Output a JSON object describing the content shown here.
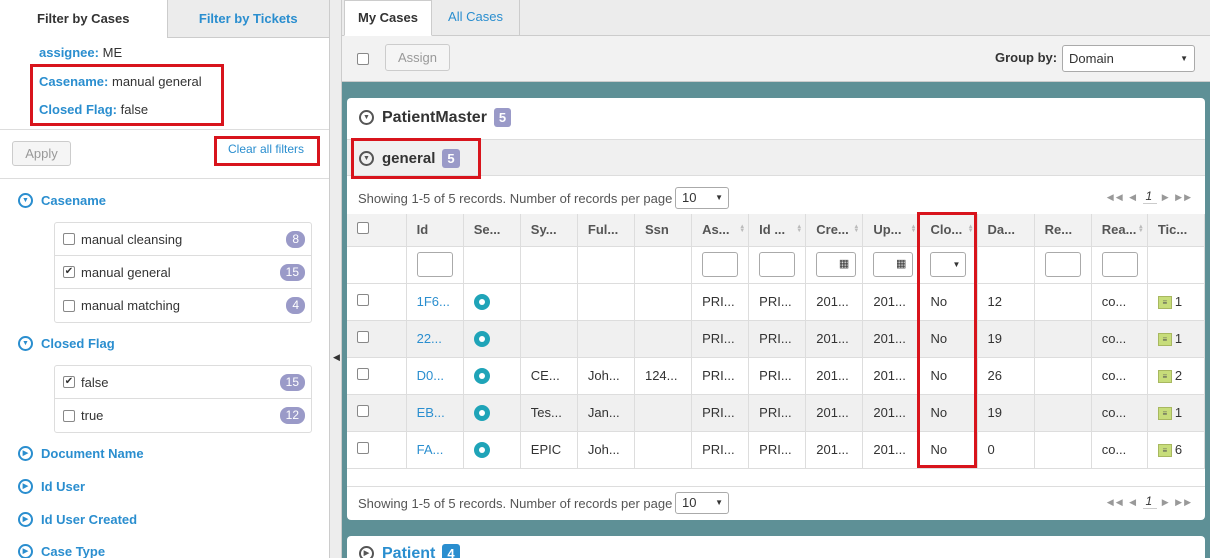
{
  "left_tabs": [
    "Filter by Cases",
    "Filter by Tickets"
  ],
  "active_filters": [
    {
      "key": "assignee:",
      "value": "ME"
    },
    {
      "key": "Casename:",
      "value": "manual general"
    },
    {
      "key": "Closed Flag:",
      "value": "false"
    }
  ],
  "apply_label": "Apply",
  "clear_label": "Clear all filters",
  "facets": {
    "casename": {
      "label": "Casename",
      "items": [
        {
          "label": "manual cleansing",
          "count": "8",
          "checked": false
        },
        {
          "label": "manual general",
          "count": "15",
          "checked": true
        },
        {
          "label": "manual matching",
          "count": "4",
          "checked": false
        }
      ]
    },
    "closed_flag": {
      "label": "Closed Flag",
      "items": [
        {
          "label": "false",
          "count": "15",
          "checked": true
        },
        {
          "label": "true",
          "count": "12",
          "checked": false
        }
      ]
    },
    "collapsed": [
      "Document Name",
      "Id User",
      "Id User Created",
      "Case Type"
    ]
  },
  "right_tabs": [
    "My Cases",
    "All Cases"
  ],
  "toolbar": {
    "assign_label": "Assign",
    "group_by_label": "Group by:",
    "group_by_value": "Domain"
  },
  "group1": {
    "name": "PatientMaster",
    "count": "5"
  },
  "subgroup": {
    "name": "general",
    "count": "5"
  },
  "pager": {
    "text": "Showing 1-5 of 5 records. Number of records per page",
    "per_page": "10",
    "page": "1"
  },
  "columns": [
    "Id",
    "Se...",
    "Sy...",
    "Ful...",
    "Ssn",
    "As...",
    "Id ...",
    "Cre...",
    "Up...",
    "Clo...",
    "Da...",
    "Re...",
    "Rea...",
    "Tic..."
  ],
  "rows": [
    [
      "1F6...",
      "",
      "",
      "",
      "",
      "PRI...",
      "PRI...",
      "201...",
      "201...",
      "No",
      "12",
      "",
      "co...",
      "1"
    ],
    [
      "22...",
      "",
      "",
      "",
      "",
      "PRI...",
      "PRI...",
      "201...",
      "201...",
      "No",
      "19",
      "",
      "co...",
      "1"
    ],
    [
      "D0...",
      "",
      "CE...",
      "Joh...",
      "124...",
      "PRI...",
      "PRI...",
      "201...",
      "201...",
      "No",
      "26",
      "",
      "co...",
      "2"
    ],
    [
      "EB...",
      "",
      "Tes...",
      "Jan...",
      "",
      "PRI...",
      "PRI...",
      "201...",
      "201...",
      "No",
      "19",
      "",
      "co...",
      "1"
    ],
    [
      "FA...",
      "",
      "EPIC",
      "Joh...",
      "",
      "PRI...",
      "PRI...",
      "201...",
      "201...",
      "No",
      "0",
      "",
      "co...",
      "6"
    ]
  ],
  "group2": {
    "name": "Patient",
    "count": "4"
  },
  "colors": {
    "accent": "#2a8ecf",
    "highlight": "#d8141c",
    "badge": "#9a9ac8",
    "background": "#5e9096"
  }
}
